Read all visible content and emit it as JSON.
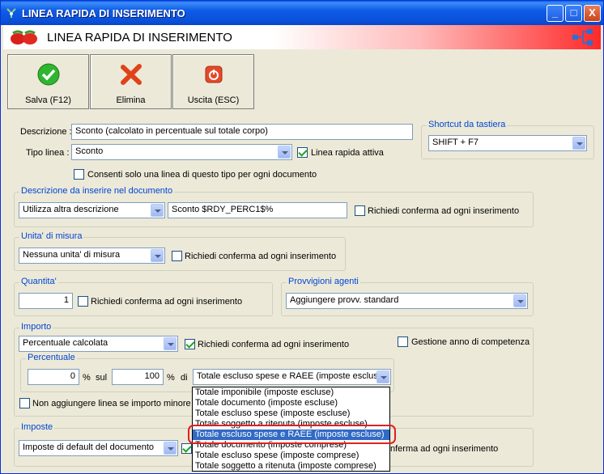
{
  "window": {
    "title": "LINEA RAPIDA DI INSERIMENTO",
    "minimize": "_",
    "maximize": "□",
    "close": "X"
  },
  "header": {
    "title": "LINEA RAPIDA DI INSERIMENTO"
  },
  "toolbar": {
    "save": "Salva (F12)",
    "delete": "Elimina",
    "exit": "Uscita (ESC)"
  },
  "form": {
    "descrizione_label": "Descrizione :",
    "descrizione_value": "Sconto (calcolato in percentuale sul totale corpo)",
    "tipo_label": "Tipo linea :",
    "tipo_value": "Sconto",
    "attiva_label": "Linea rapida attiva",
    "consenti_label": "Consenti solo una linea di questo tipo per ogni documento"
  },
  "shortcut": {
    "legend": "Shortcut da tastiera",
    "value": "SHIFT + F7"
  },
  "descrizione_doc": {
    "legend": "Descrizione da inserire nel documento",
    "select_value": "Utilizza altra descrizione",
    "text_value": "Sconto $RDY_PERC1$%",
    "confirm_label": "Richiedi conferma ad ogni inserimento"
  },
  "unita": {
    "legend": "Unita' di misura",
    "value": "Nessuna unita' di misura",
    "confirm_label": "Richiedi conferma ad ogni inserimento"
  },
  "quantita": {
    "legend": "Quantita'",
    "value": "1",
    "confirm_label": "Richiedi conferma ad ogni inserimento"
  },
  "provvigioni": {
    "legend": "Provvigioni agenti",
    "value": "Aggiungere provv. standard"
  },
  "importo": {
    "legend": "Importo",
    "value": "Percentuale calcolata",
    "confirm_label": "Richiedi conferma ad ogni inserimento",
    "anno_label": "Gestione anno di competenza",
    "no_add_label": "Non aggiungere linea se importo minore o"
  },
  "percentuale": {
    "legend": "Percentuale",
    "value1": "0",
    "pct1": "%",
    "sul": "sul",
    "value2": "100",
    "pct2": "%",
    "di": "di",
    "base_value": "Totale escluso spese e RAEE (imposte escluse)"
  },
  "dropdown_options": [
    "Totale imponibile (imposte escluse)",
    "Totale documento (imposte escluse)",
    "Totale escluso spese (imposte escluse)",
    "Totale soggetto a ritenuta (imposte escluse)",
    "Totale escluso spese e RAEE (imposte escluse)",
    "Totale documento (imposte comprese)",
    "Totale escluso spese (imposte comprese)",
    "Totale soggetto a ritenuta (imposte comprese)"
  ],
  "imposte": {
    "legend": "Imposte",
    "value": "Imposte di default del documento",
    "confirm_partial": "nferma ad ogni inserimento"
  },
  "colors": {
    "title_blue": "#0a4fd8",
    "legend_blue": "#0046d5",
    "selection": "#316ac5",
    "ring": "#e02020"
  }
}
